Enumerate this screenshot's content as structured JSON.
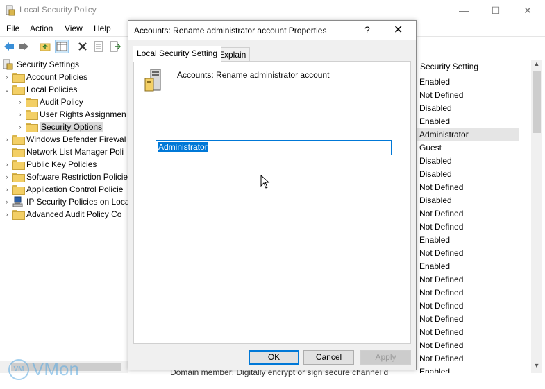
{
  "window": {
    "title": "Local Security Policy",
    "minimize_glyph": "—",
    "maximize_glyph": "☐",
    "close_glyph": "✕"
  },
  "menu": [
    "File",
    "Action",
    "View",
    "Help"
  ],
  "tree": {
    "root": "Security Settings",
    "items": [
      "Account Policies",
      "Local Policies",
      "Audit Policy",
      "User Rights Assignmen",
      "Security Options",
      "Windows Defender Firewal",
      "Network List Manager Poli",
      "Public Key Policies",
      "Software Restriction Policie",
      "Application Control Policie",
      "IP Security Policies on Loca",
      "Advanced Audit Policy Co"
    ]
  },
  "list": {
    "column_header": "Security Setting",
    "values": [
      "Enabled",
      "Not Defined",
      "Disabled",
      "Enabled",
      "Administrator",
      "Guest",
      "Disabled",
      "Disabled",
      "Not Defined",
      "Disabled",
      "Not Defined",
      "Not Defined",
      "Enabled",
      "Not Defined",
      "Enabled",
      "Not Defined",
      "Not Defined",
      "Not Defined",
      "Not Defined",
      "Not Defined",
      "Not Defined",
      "Not Defined",
      "Enabled"
    ],
    "selected_index": 4,
    "bottom_row_text": "Domain member: Digitally encrypt or sign secure channel d"
  },
  "dialog": {
    "title": "Accounts: Rename administrator account Properties",
    "help_glyph": "?",
    "close_glyph": "✕",
    "tabs": [
      "Local Security Setting",
      "Explain"
    ],
    "active_tab": 0,
    "policy_name": "Accounts: Rename administrator account",
    "value": "Administrator",
    "buttons": {
      "ok": "OK",
      "cancel": "Cancel",
      "apply": "Apply"
    }
  },
  "watermark": {
    "badge": "VM",
    "text": "VMon"
  }
}
